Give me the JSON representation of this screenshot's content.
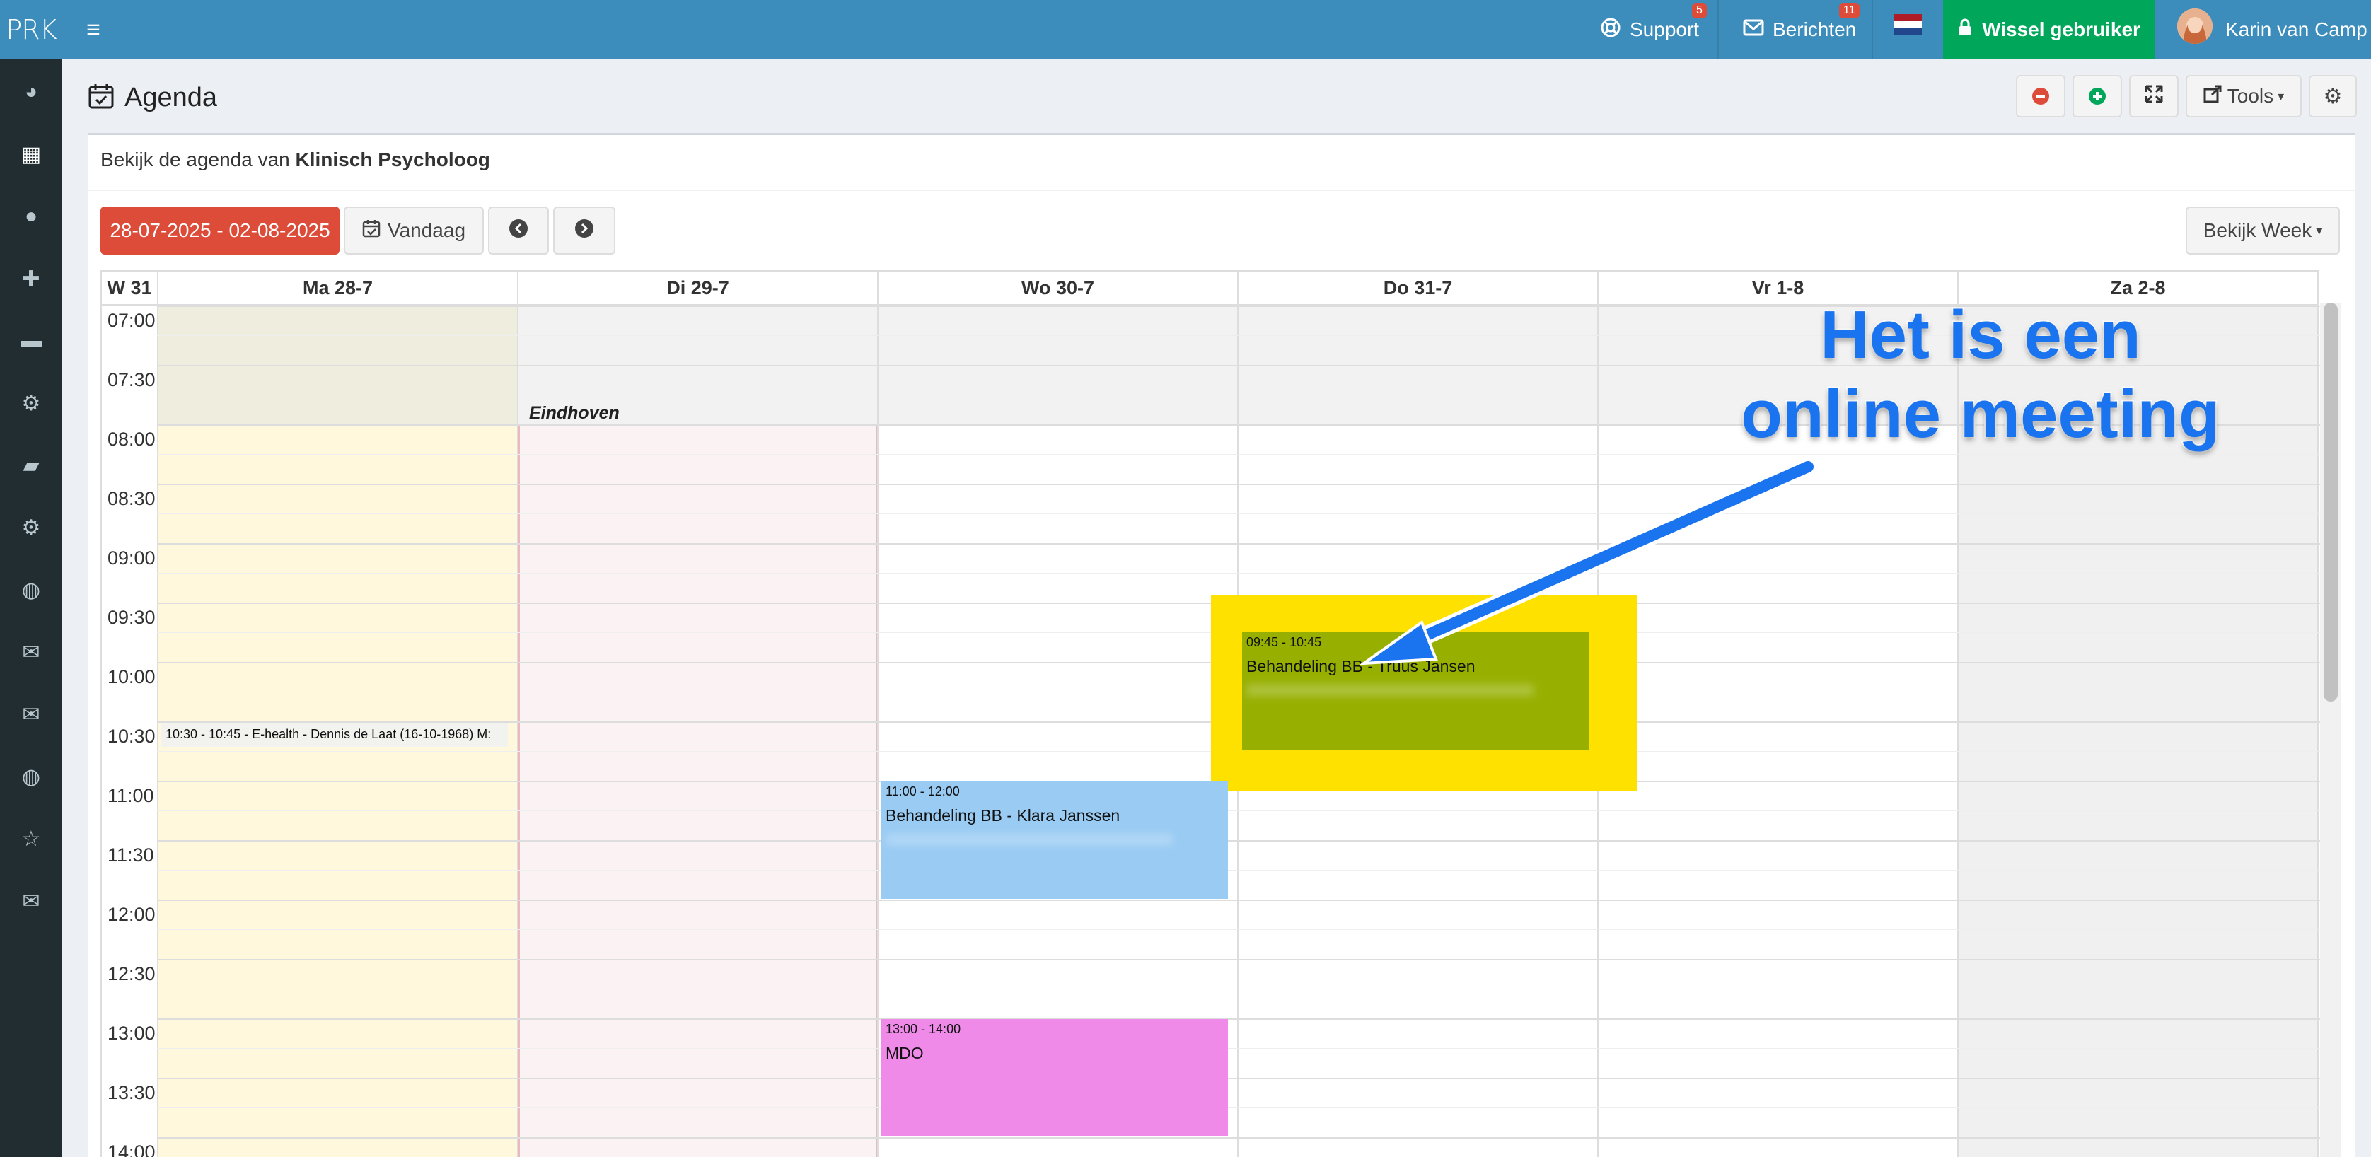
{
  "app": {
    "brand": "PRK"
  },
  "topbar": {
    "support_label": "Support",
    "support_badge": "5",
    "messages_label": "Berichten",
    "messages_badge": "11",
    "switch_user_label": "Wissel gebruiker",
    "user_name": "Karin van Camp"
  },
  "sidebar": {
    "items": [
      "dashboard-icon",
      "calendar-icon",
      "user-icon",
      "medkit-icon",
      "book-icon",
      "cogs-icon",
      "truck-icon",
      "gear-icon",
      "globe-icon",
      "envelope-open-icon",
      "envelope-icon",
      "globe-icon",
      "star-icon",
      "envelope-filled-icon"
    ]
  },
  "page": {
    "title": "Agenda",
    "subtitle_prefix": "Bekijk de agenda van",
    "subtitle_name": "Klinisch Psycholoog",
    "tools_label": "Tools"
  },
  "toolbar": {
    "date_range": "28-07-2025 - 02-08-2025",
    "today_label": "Vandaag",
    "view_label": "Bekijk Week"
  },
  "calendar": {
    "week_label": "W 31",
    "days": [
      "Ma 28-7",
      "Di 29-7",
      "Wo 30-7",
      "Do 31-7",
      "Vr 1-8",
      "Za 2-8"
    ],
    "times": [
      "07:00",
      "07:30",
      "08:00",
      "08:30",
      "09:00",
      "09:30",
      "10:00",
      "10:30",
      "11:00",
      "11:30",
      "12:00",
      "12:30",
      "13:00",
      "13:30",
      "14:00"
    ],
    "location_label": "Eindhoven",
    "events": [
      {
        "time": "10:30 - 10:45 - E-health - Dennis de Laat (16-10-1968) M:",
        "name": ""
      },
      {
        "time": "09:45 - 10:45",
        "name": "Behandeling BB - Truus Jansen",
        "color": "#97b000"
      },
      {
        "time": "11:00 - 12:00",
        "name": "Behandeling BB - Klara Janssen",
        "color": "#99cbf3"
      },
      {
        "time": "13:00 - 14:00",
        "name": "MDO",
        "color": "#ef8ae9"
      }
    ]
  },
  "annotation": {
    "line1": "Het is een",
    "line2": "online meeting"
  },
  "colors": {
    "topbar": "#3c8dbc",
    "sidebar": "#222d32",
    "switch": "#00a65a",
    "danger": "#dd4b39",
    "highlight": "#ffe100",
    "arrow": "#1a74ef"
  }
}
